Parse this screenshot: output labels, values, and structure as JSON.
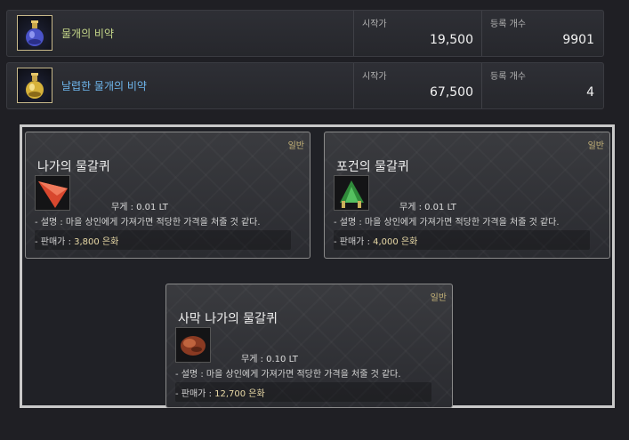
{
  "market": {
    "rows": [
      {
        "name": "물개의 비약",
        "name_color": "#c6d88a",
        "start_price_label": "시작가",
        "start_price": "19,500",
        "count_label": "등록 개수",
        "count": "9901"
      },
      {
        "name": "날렵한 물개의 비약",
        "name_color": "#6fb7ee",
        "start_price_label": "시작가",
        "start_price": "67,500",
        "count_label": "등록 개수",
        "count": "4"
      }
    ]
  },
  "cards": [
    {
      "grade": "일반",
      "title": "나가의 물갈퀴",
      "icon": "red-fin-icon",
      "weight": "무게 :   0.01 LT",
      "desc": "- 설명 : 마을 상인에게 가져가면 적당한 가격을 처줄 것 같다.",
      "price_label": "- 판매가 :",
      "price": "3,800 은화"
    },
    {
      "grade": "일반",
      "title": "포건의 물갈퀴",
      "icon": "green-fin-icon",
      "weight": "무게 :   0.01 LT",
      "desc": "- 설명 : 마을 상인에게 가져가면 적당한 가격을 처줄 것 같다.",
      "price_label": "- 판매가 :",
      "price": "4,000 은화"
    },
    {
      "grade": "일반",
      "title": "사막 나가의 물갈퀴",
      "icon": "brown-fin-icon",
      "weight": "무게 :   0.10 LT",
      "desc": "- 설명 : 마을 상인에게 가져가면 적당한 가격을 처줄 것 같다.",
      "price_label": "- 판매가 :",
      "price": "12,700 은화"
    }
  ]
}
